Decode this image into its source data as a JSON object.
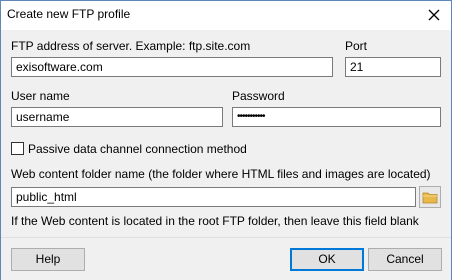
{
  "window": {
    "title": "Create new FTP profile",
    "close_icon": "close-icon"
  },
  "form": {
    "ftp_address_label": "FTP address of server. Example: ftp.site.com",
    "ftp_address_value": "exisoftware.com",
    "port_label": "Port",
    "port_value": "21",
    "username_label": "User name",
    "username_value": "username",
    "password_label": "Password",
    "password_value": "•••••••••••",
    "passive_label": "Passive data channel connection method",
    "passive_checked": false,
    "content_folder_label": "Web content folder name (the folder where HTML files and images are located)",
    "content_folder_value": "public_html",
    "folder_icon": "folder-icon",
    "hint": "If the Web content is located in the root FTP folder, then leave this field blank"
  },
  "buttons": {
    "help": "Help",
    "ok": "OK",
    "cancel": "Cancel"
  },
  "colors": {
    "accent": "#0078d7",
    "folder": "#e8b84a"
  }
}
